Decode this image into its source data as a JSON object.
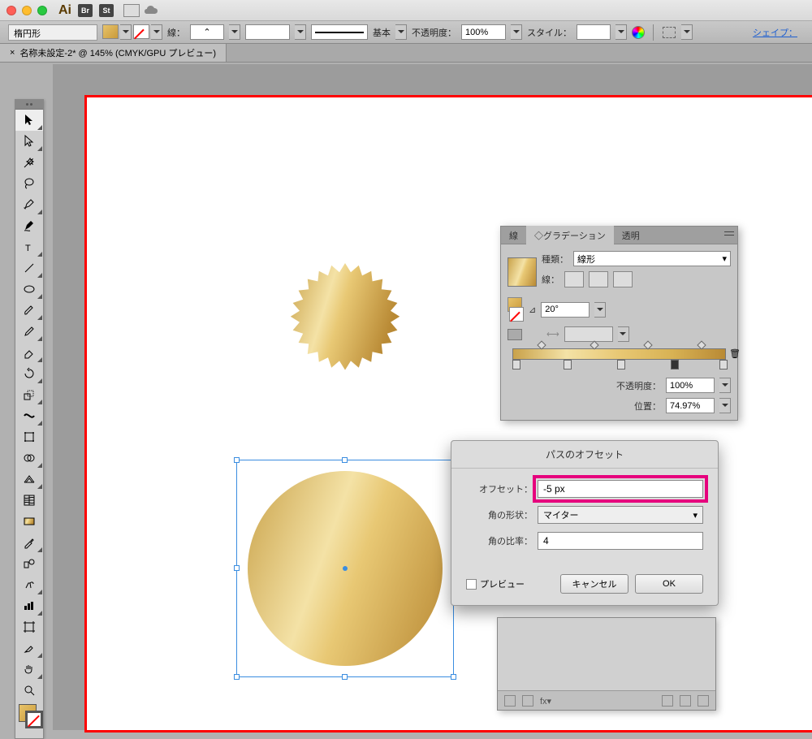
{
  "titlebar": {
    "app": "Ai",
    "br": "Br",
    "st": "St"
  },
  "options": {
    "tool": "楕円形",
    "fill_label": "",
    "stroke_label": "線：",
    "stroke_pt": "",
    "width_label": "",
    "profile": "基本",
    "opacity_label": "不透明度：",
    "opacity": "100%",
    "style_label": "スタイル：",
    "shape_link": "シェイプ："
  },
  "tab": {
    "name": "名称未設定-2* @ 145% (CMYK/GPU プレビュー)",
    "close": "×"
  },
  "gradient": {
    "tab_stroke": "線",
    "tab_grad": "グラデーション",
    "tab_trans": "透明",
    "diamond": "◇",
    "type_label": "種類：",
    "type": "線形",
    "stroke_label": "線：",
    "angle_label": "⊿",
    "angle": "20°",
    "ar_label": "",
    "opacity_label": "不透明度：",
    "opacity": "100%",
    "loc_label": "位置：",
    "loc": "74.97%",
    "trash": "🗑"
  },
  "dialog": {
    "title": "パスのオフセット",
    "offset_label": "オフセット：",
    "offset": "-5 px",
    "join_label": "角の形状：",
    "join": "マイター",
    "miter_label": "角の比率：",
    "miter": "4",
    "preview": "プレビュー",
    "cancel": "キャンセル",
    "ok": "OK"
  },
  "layers": {
    "fx": "fx▾"
  }
}
